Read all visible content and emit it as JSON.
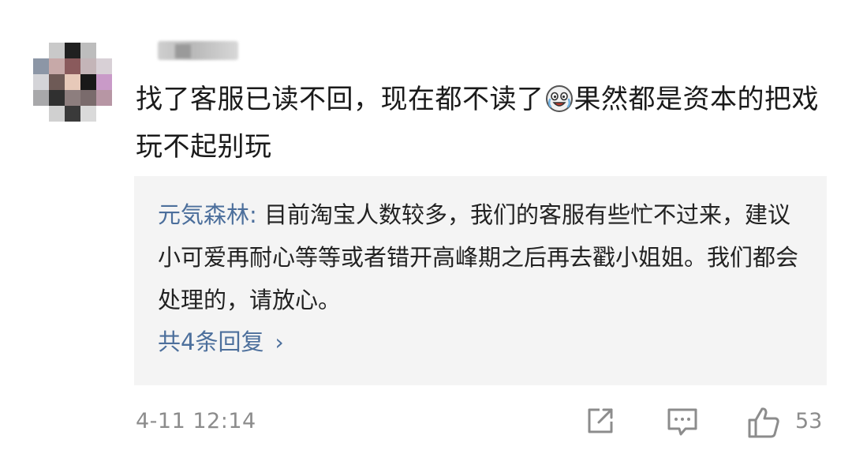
{
  "comment": {
    "text_part1": "找了客服已读不回，现在都不读了",
    "emoji_icon": "crying-laughing-face-icon",
    "text_part2": "果然都是资本的把戏 玩不起别玩"
  },
  "reply": {
    "author": "元気森林:",
    "text": " 目前淘宝人数较多，我们的客服有些忙不过来，建议小可爱再耐心等等或者错开高峰期之后再去戳小姐姐。我们都会处理的，请放心。",
    "more_label": "共4条回复",
    "more_chevron": "›"
  },
  "footer": {
    "timestamp": "4-11 12:14",
    "share_icon": "share-icon",
    "comment_icon": "comment-icon",
    "like_icon": "thumbs-up-icon",
    "like_count": "53"
  },
  "colors": {
    "link_blue": "#4c6f9c",
    "reply_bg": "#f4f4f4",
    "meta_gray": "#8c8c8c",
    "text_dark": "#1a1a1a"
  }
}
